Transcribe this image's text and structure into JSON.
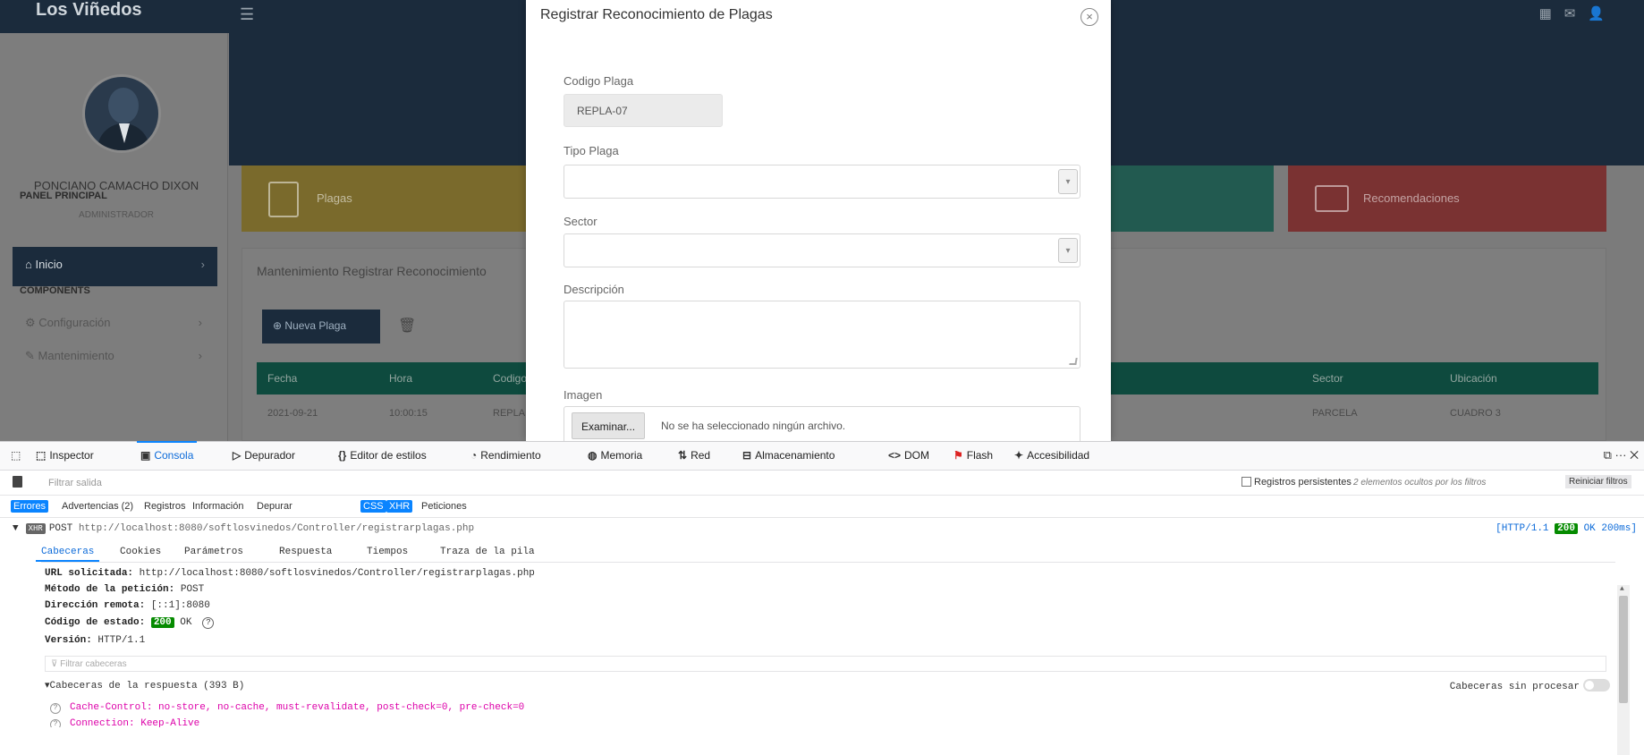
{
  "app": {
    "brand": "Los Viñedos",
    "user_name": "PONCIANO CAMACHO DIXON",
    "user_role": "ADMINISTRADOR",
    "section_main": "PANEL PRINCIPAL",
    "nav_home": "Inicio",
    "section_components": "COMPONENTS",
    "nav_config": "Configuración",
    "nav_maintenance": "Mantenimiento",
    "tile_yellow": "Plagas",
    "tile_red": "Recomendaciones",
    "panel_title": "Mantenimiento Registrar Reconocimiento",
    "nuevo_button": "Nueva Plaga",
    "table_headers": [
      "Fecha",
      "Hora",
      "Codigo",
      "Sector",
      "Ubicación"
    ],
    "table_row": [
      "2021-09-21",
      "10:00:15",
      "REPLA",
      "PARCELA",
      "CUADRO 3"
    ],
    "colors": {
      "topbar": "#1b2b3c",
      "tile_yellow": "#f0b400",
      "tile_green": "#0f7a63",
      "tile_red": "#d03535",
      "table_header": "#0e4a3e"
    }
  },
  "modal": {
    "title": "Registrar Reconocimiento de Plagas",
    "close_icon": "close-circle-icon",
    "code_label": "Codigo Plaga",
    "code_value": "REPLA-07",
    "type_label": "Tipo Plaga",
    "sector_label": "Sector",
    "description_label": "Descripción",
    "image_label": "Imagen",
    "browse_button": "Examinar...",
    "no_file_text": "No se ha seleccionado ningún archivo."
  },
  "devtools": {
    "tabs": [
      {
        "icon": "⬚",
        "label": "Inspector"
      },
      {
        "icon": "▣",
        "label": "Consola"
      },
      {
        "icon": "▷",
        "label": "Depurador"
      },
      {
        "icon": "{}",
        "label": "Editor de estilos"
      },
      {
        "icon": "◔",
        "label": "Rendimiento"
      },
      {
        "icon": "◍",
        "label": "Memoria"
      },
      {
        "icon": "⇅",
        "label": "Red"
      },
      {
        "icon": "⊟",
        "label": "Almacenamiento"
      },
      {
        "icon": "<>",
        "label": "DOM"
      },
      {
        "icon": "⚑",
        "label": "Flash"
      },
      {
        "icon": "✦",
        "label": "Accesibilidad"
      }
    ],
    "filter_placeholder": "Filtrar salida",
    "persist_logs": "Registros persistentes",
    "hidden_by_filters": "2 elementos ocultos por los filtros",
    "reset_filters": "Reiniciar filtros",
    "levels": [
      "Errores",
      "Advertencias (2)",
      "Registros",
      "Información",
      "Depurar",
      "CSS",
      "XHR",
      "Peticiones"
    ],
    "request": {
      "badge": "XHR",
      "method": "POST",
      "url": "http://localhost:8080/softlosvinedos/Controller/registrarplagas.php",
      "protocol": "[HTTP/1.1",
      "status_code": "200",
      "status_rest": "OK 200ms]",
      "sub_tabs": [
        "Cabeceras",
        "Cookies",
        "Parámetros",
        "Respuesta",
        "Tiempos",
        "Traza de la pila"
      ],
      "url_label": "URL solicitada:",
      "url_value": "http://localhost:8080/softlosvinedos/Controller/registrarplagas.php",
      "method_label": "Método de la petición:",
      "method_value": "POST",
      "remote_label": "Dirección remota:",
      "remote_value": "[::1]:8080",
      "status_label": "Código de estado:",
      "status_text": "OK",
      "version_label": "Versión:",
      "version_value": "HTTP/1.1",
      "filter_headers": "Filtrar cabeceras",
      "response_headers": "Cabeceras de la respuesta (393 B)",
      "raw_headers": "Cabeceras sin procesar",
      "cache_control": "Cache-Control: no-store, no-cache, must-revalidate, post-check=0, pre-check=0",
      "connection": "Connection: Keep-Alive"
    }
  }
}
